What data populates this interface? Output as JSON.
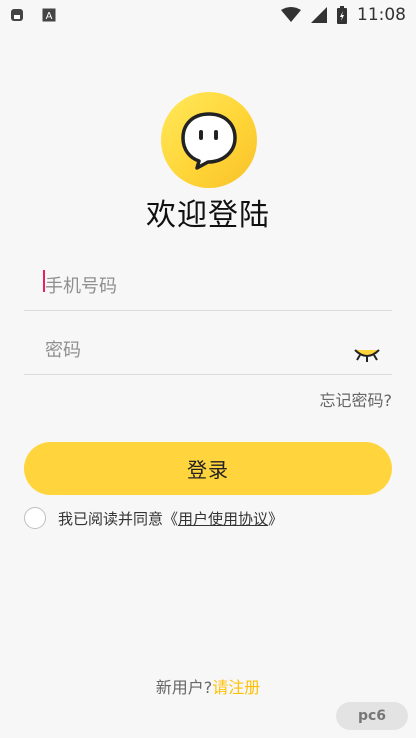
{
  "status_bar": {
    "time": "11:08"
  },
  "title": "欢迎登陆",
  "phone_field": {
    "placeholder": "手机号码"
  },
  "password_field": {
    "placeholder": "密码"
  },
  "forgot_link": "忘记密码?",
  "login_button": "登录",
  "agreement": {
    "prefix": "我已阅读并同意",
    "open_quote": "《",
    "link": "用户使用协议",
    "close_quote": "》"
  },
  "register": {
    "prefix": "新用户?",
    "link": "请注册"
  },
  "colors": {
    "accent": "#ffd43d",
    "link_accent": "#ffc107",
    "caret": "#e91e63",
    "background": "#f7f7f7"
  },
  "watermark": {
    "text": "pc6"
  },
  "icons": [
    "sim-card-icon",
    "a-letter-icon",
    "wifi-icon",
    "signal-icon",
    "battery-charging-icon",
    "chat-bubble-logo",
    "eye-closed-icon"
  ]
}
